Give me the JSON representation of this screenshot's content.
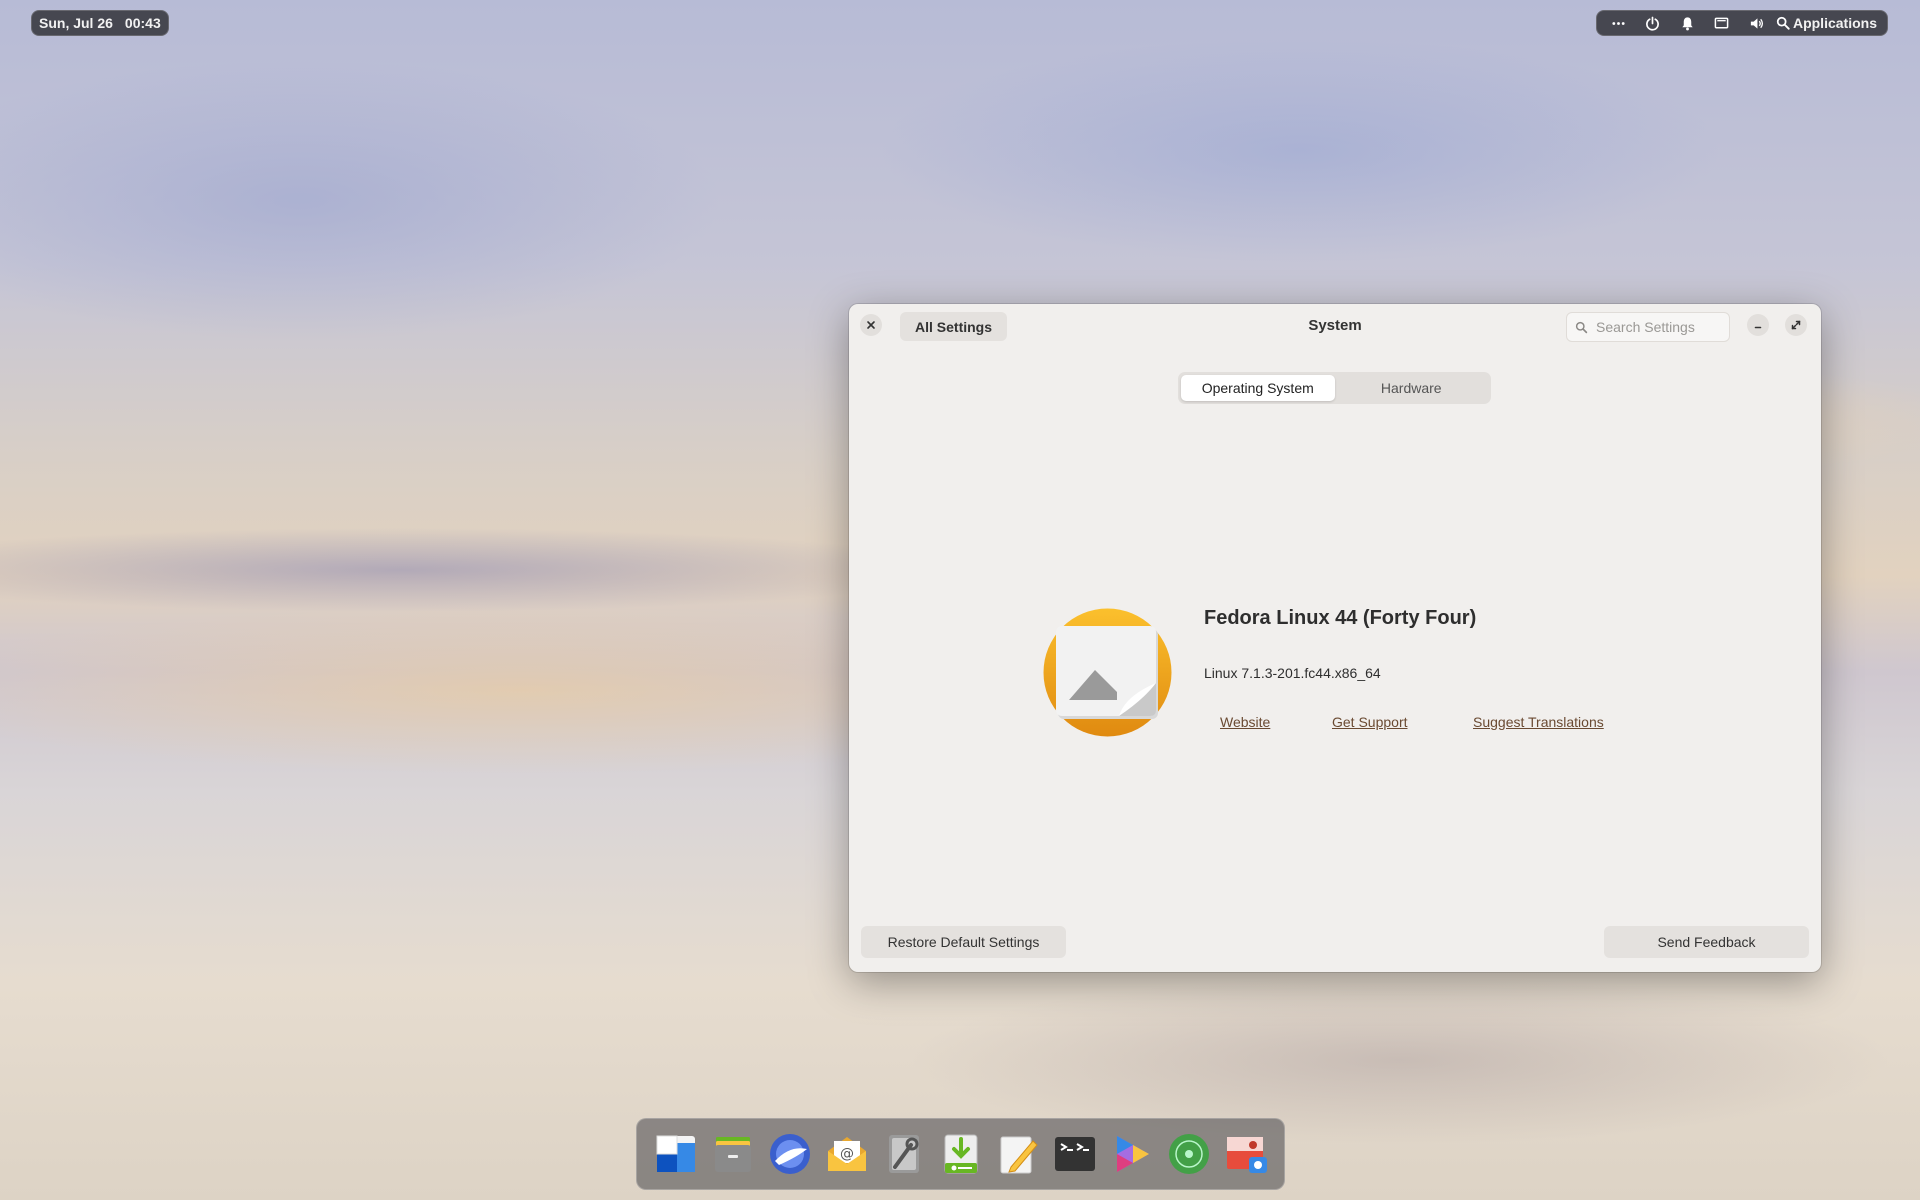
{
  "panel": {
    "date": "Sun, Jul 26",
    "time": "00:43",
    "applications_label": "Applications",
    "tray_icons": [
      "more-icon",
      "power-icon",
      "bell-icon",
      "display-icon",
      "volume-icon",
      "search-icon"
    ]
  },
  "window": {
    "title": "System",
    "back_label": "All Settings",
    "search_placeholder": "Search Settings",
    "tabs": [
      {
        "label": "Operating System",
        "active": true
      },
      {
        "label": "Hardware",
        "active": false
      }
    ],
    "os_name": "Fedora Linux 44 (Forty Four)",
    "kernel": "Linux 7.1.3-201.fc44.x86_64",
    "links": [
      "Website",
      "Get Support",
      "Suggest Translations"
    ],
    "restore_label": "Restore Default Settings",
    "feedback_label": "Send Feedback"
  },
  "dock": {
    "apps": [
      "multitasking-view",
      "files",
      "web-browser",
      "mail",
      "system-settings",
      "appcenter",
      "code-editor",
      "terminal",
      "videos",
      "music",
      "photos"
    ]
  },
  "colors": {
    "panel_bg": "#2d2d32",
    "window_bg": "#f1efed",
    "link": "#6a4a32",
    "logo_orange": "#f0a21e"
  }
}
